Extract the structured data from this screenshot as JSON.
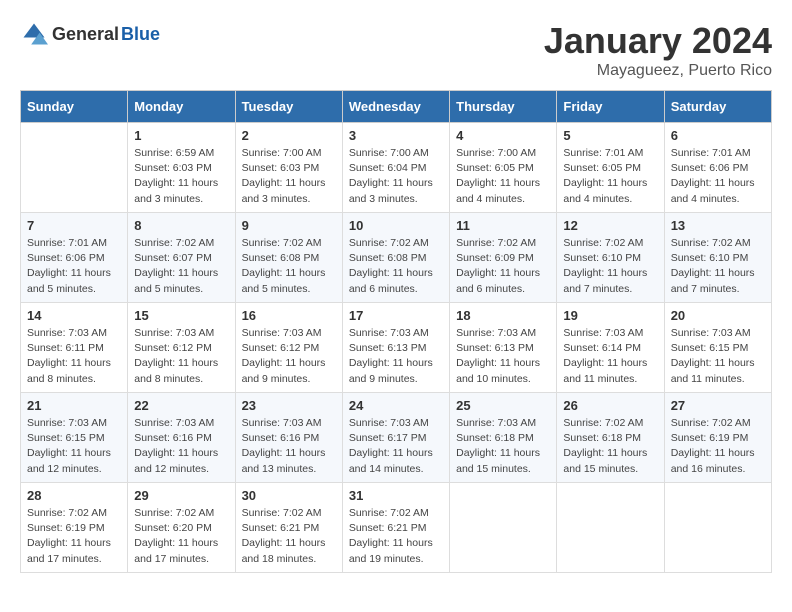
{
  "logo": {
    "general": "General",
    "blue": "Blue"
  },
  "header": {
    "month": "January 2024",
    "location": "Mayagueez, Puerto Rico"
  },
  "days_of_week": [
    "Sunday",
    "Monday",
    "Tuesday",
    "Wednesday",
    "Thursday",
    "Friday",
    "Saturday"
  ],
  "weeks": [
    [
      {
        "day": "",
        "info": ""
      },
      {
        "day": "1",
        "info": "Sunrise: 6:59 AM\nSunset: 6:03 PM\nDaylight: 11 hours\nand 3 minutes."
      },
      {
        "day": "2",
        "info": "Sunrise: 7:00 AM\nSunset: 6:03 PM\nDaylight: 11 hours\nand 3 minutes."
      },
      {
        "day": "3",
        "info": "Sunrise: 7:00 AM\nSunset: 6:04 PM\nDaylight: 11 hours\nand 3 minutes."
      },
      {
        "day": "4",
        "info": "Sunrise: 7:00 AM\nSunset: 6:05 PM\nDaylight: 11 hours\nand 4 minutes."
      },
      {
        "day": "5",
        "info": "Sunrise: 7:01 AM\nSunset: 6:05 PM\nDaylight: 11 hours\nand 4 minutes."
      },
      {
        "day": "6",
        "info": "Sunrise: 7:01 AM\nSunset: 6:06 PM\nDaylight: 11 hours\nand 4 minutes."
      }
    ],
    [
      {
        "day": "7",
        "info": "Sunrise: 7:01 AM\nSunset: 6:06 PM\nDaylight: 11 hours\nand 5 minutes."
      },
      {
        "day": "8",
        "info": "Sunrise: 7:02 AM\nSunset: 6:07 PM\nDaylight: 11 hours\nand 5 minutes."
      },
      {
        "day": "9",
        "info": "Sunrise: 7:02 AM\nSunset: 6:08 PM\nDaylight: 11 hours\nand 5 minutes."
      },
      {
        "day": "10",
        "info": "Sunrise: 7:02 AM\nSunset: 6:08 PM\nDaylight: 11 hours\nand 6 minutes."
      },
      {
        "day": "11",
        "info": "Sunrise: 7:02 AM\nSunset: 6:09 PM\nDaylight: 11 hours\nand 6 minutes."
      },
      {
        "day": "12",
        "info": "Sunrise: 7:02 AM\nSunset: 6:10 PM\nDaylight: 11 hours\nand 7 minutes."
      },
      {
        "day": "13",
        "info": "Sunrise: 7:02 AM\nSunset: 6:10 PM\nDaylight: 11 hours\nand 7 minutes."
      }
    ],
    [
      {
        "day": "14",
        "info": "Sunrise: 7:03 AM\nSunset: 6:11 PM\nDaylight: 11 hours\nand 8 minutes."
      },
      {
        "day": "15",
        "info": "Sunrise: 7:03 AM\nSunset: 6:12 PM\nDaylight: 11 hours\nand 8 minutes."
      },
      {
        "day": "16",
        "info": "Sunrise: 7:03 AM\nSunset: 6:12 PM\nDaylight: 11 hours\nand 9 minutes."
      },
      {
        "day": "17",
        "info": "Sunrise: 7:03 AM\nSunset: 6:13 PM\nDaylight: 11 hours\nand 9 minutes."
      },
      {
        "day": "18",
        "info": "Sunrise: 7:03 AM\nSunset: 6:13 PM\nDaylight: 11 hours\nand 10 minutes."
      },
      {
        "day": "19",
        "info": "Sunrise: 7:03 AM\nSunset: 6:14 PM\nDaylight: 11 hours\nand 11 minutes."
      },
      {
        "day": "20",
        "info": "Sunrise: 7:03 AM\nSunset: 6:15 PM\nDaylight: 11 hours\nand 11 minutes."
      }
    ],
    [
      {
        "day": "21",
        "info": "Sunrise: 7:03 AM\nSunset: 6:15 PM\nDaylight: 11 hours\nand 12 minutes."
      },
      {
        "day": "22",
        "info": "Sunrise: 7:03 AM\nSunset: 6:16 PM\nDaylight: 11 hours\nand 12 minutes."
      },
      {
        "day": "23",
        "info": "Sunrise: 7:03 AM\nSunset: 6:16 PM\nDaylight: 11 hours\nand 13 minutes."
      },
      {
        "day": "24",
        "info": "Sunrise: 7:03 AM\nSunset: 6:17 PM\nDaylight: 11 hours\nand 14 minutes."
      },
      {
        "day": "25",
        "info": "Sunrise: 7:03 AM\nSunset: 6:18 PM\nDaylight: 11 hours\nand 15 minutes."
      },
      {
        "day": "26",
        "info": "Sunrise: 7:02 AM\nSunset: 6:18 PM\nDaylight: 11 hours\nand 15 minutes."
      },
      {
        "day": "27",
        "info": "Sunrise: 7:02 AM\nSunset: 6:19 PM\nDaylight: 11 hours\nand 16 minutes."
      }
    ],
    [
      {
        "day": "28",
        "info": "Sunrise: 7:02 AM\nSunset: 6:19 PM\nDaylight: 11 hours\nand 17 minutes."
      },
      {
        "day": "29",
        "info": "Sunrise: 7:02 AM\nSunset: 6:20 PM\nDaylight: 11 hours\nand 17 minutes."
      },
      {
        "day": "30",
        "info": "Sunrise: 7:02 AM\nSunset: 6:21 PM\nDaylight: 11 hours\nand 18 minutes."
      },
      {
        "day": "31",
        "info": "Sunrise: 7:02 AM\nSunset: 6:21 PM\nDaylight: 11 hours\nand 19 minutes."
      },
      {
        "day": "",
        "info": ""
      },
      {
        "day": "",
        "info": ""
      },
      {
        "day": "",
        "info": ""
      }
    ]
  ]
}
